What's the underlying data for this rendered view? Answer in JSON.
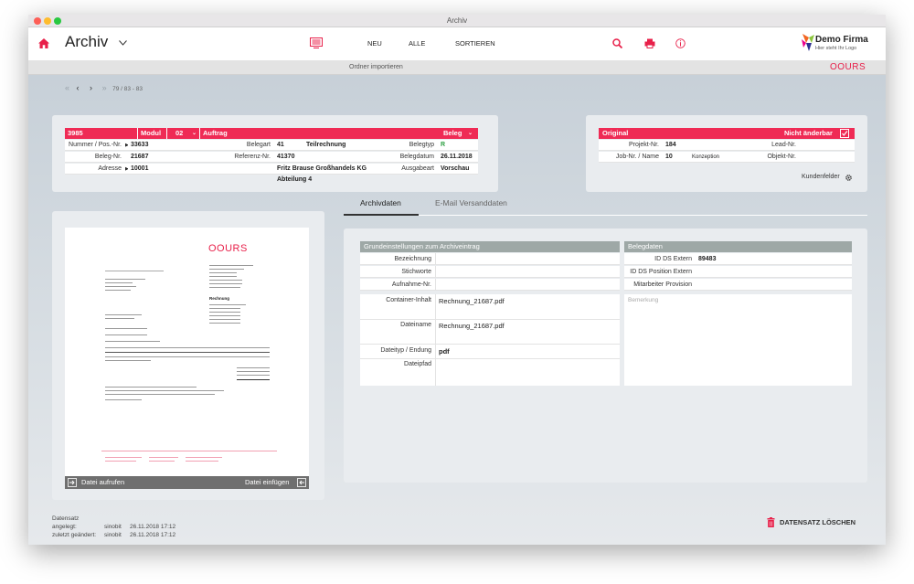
{
  "window": {
    "title": "Archiv"
  },
  "toolbar": {
    "app_title": "Archiv",
    "nav": [
      "NEU",
      "ALLE",
      "SORTIEREN"
    ],
    "brand_name": "Demo Firma",
    "brand_sub": "Hier steht Ihr Logo"
  },
  "subbar": {
    "label": "Ordner importieren",
    "brand": "OOURS"
  },
  "pager": {
    "text": "79 / 83 - 83"
  },
  "beleg": {
    "header": {
      "nr": "3985",
      "modul_label": "Modul",
      "modul_value": "02",
      "type": "Auftrag",
      "right": "Beleg"
    },
    "rows": [
      {
        "l1": "Nummer / Pos.-Nr.",
        "v1": "33633",
        "l2": "Belegart",
        "v2": "41",
        "v2b": "Teilrechnung",
        "l3": "Belegtyp",
        "v3": "R"
      },
      {
        "l1": "Beleg-Nr.",
        "v1": "21687",
        "l2": "Referenz-Nr.",
        "v2": "41370",
        "v2b": "",
        "l3": "Belegdatum",
        "v3": "26.11.2018"
      },
      {
        "l1": "Adresse",
        "v1": "10001",
        "l2": "",
        "v2": "Fritz Brause Großhandels KG Abteilung 4",
        "v2b": "",
        "l3": "Ausgabeart",
        "v3": "Vorschau"
      }
    ]
  },
  "original": {
    "header": {
      "left": "Original",
      "right": "Nicht änderbar"
    },
    "rows": [
      {
        "l1": "Projekt-Nr.",
        "v1": "184",
        "v1b": "",
        "l2": "Lead-Nr.",
        "v2": ""
      },
      {
        "l1": "Job-Nr. / Name",
        "v1": "10",
        "v1b": "Konzeption",
        "l2": "Objekt-Nr.",
        "v2": ""
      }
    ],
    "kundenfelder": "Kundenfelder"
  },
  "preview": {
    "brand": "OOURS",
    "heading": "Rechnung",
    "btn_left": "Datei aufrufen",
    "btn_right": "Datei einfügen"
  },
  "tabs": [
    "Archivdaten",
    "E-Mail Versanddaten"
  ],
  "grund": {
    "title": "Grundeinstellungen zum Archiveintrag",
    "fields": [
      {
        "label": "Bezeichnung",
        "value": ""
      },
      {
        "label": "Stichworte",
        "value": ""
      },
      {
        "label": "Aufnahme-Nr.",
        "value": ""
      }
    ],
    "files": [
      {
        "label": "Container-Inhalt",
        "value": "Rechnung_21687.pdf"
      },
      {
        "label": "Dateiname",
        "value": "Rechnung_21687.pdf"
      },
      {
        "label": "Dateityp / Endung",
        "value": "pdf"
      },
      {
        "label": "Dateipfad",
        "value": ""
      }
    ]
  },
  "belegdaten": {
    "title": "Belegdaten",
    "fields": [
      {
        "label": "ID DS Extern",
        "value": "89483"
      },
      {
        "label": "ID DS Position Extern",
        "value": ""
      },
      {
        "label": "Mitarbeiter Provision",
        "value": ""
      }
    ],
    "bemerkung_placeholder": "Bemerkung"
  },
  "footer": {
    "angelegt_label": "Datensatz angelegt:",
    "angelegt_user": "sinobit",
    "angelegt_date": "26.11.2018 17:12",
    "geaendert_label": "zuletzt geändert:",
    "geaendert_user": "sinobit",
    "geaendert_date": "26.11.2018 17:12",
    "delete_label": "DATENSATZ LÖSCHEN"
  },
  "colors": {
    "accent": "#ef2b55",
    "section_gray": "#9ea8a6"
  }
}
